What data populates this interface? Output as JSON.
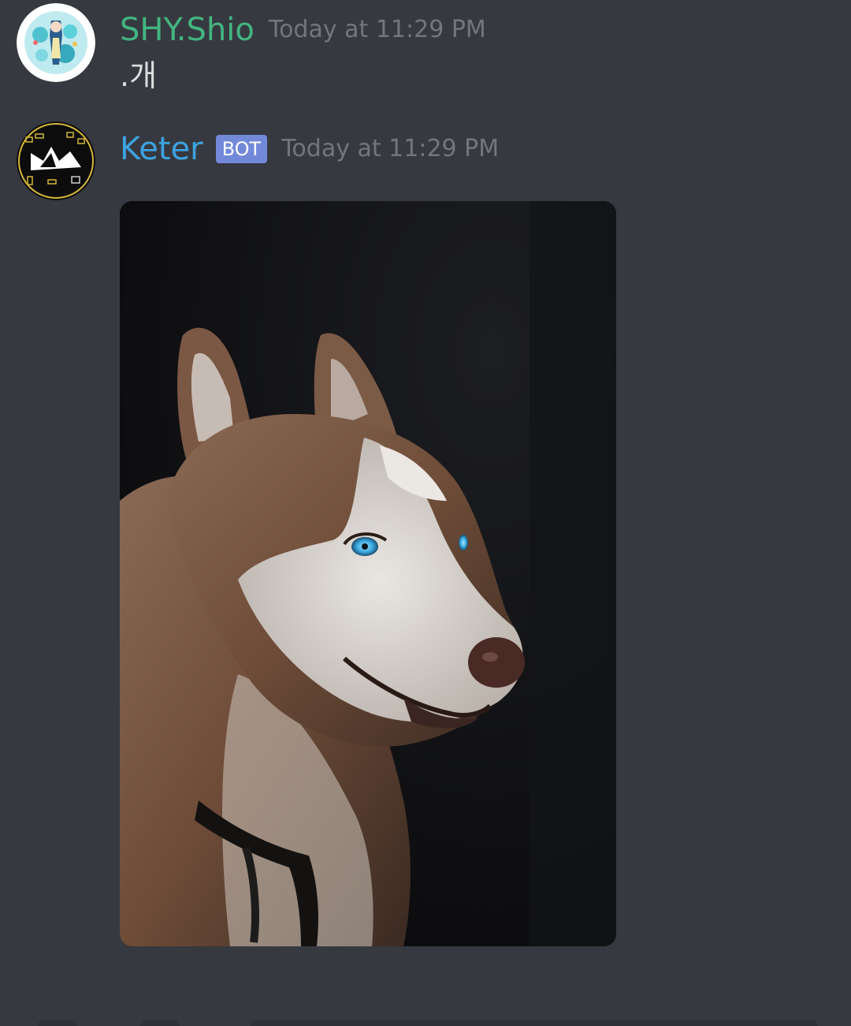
{
  "messages": [
    {
      "author": "SHY.Shio",
      "author_color": "#43b581",
      "timestamp": "Today at 11:29 PM",
      "content": ".개",
      "avatar_icon": "anime-character-avatar"
    },
    {
      "author": "Keter",
      "author_color": "#3ea2e0",
      "bot_tag": "BOT",
      "timestamp": "Today at 11:29 PM",
      "avatar_icon": "keter-bot-logo-avatar",
      "attachment": {
        "type": "image",
        "subject": "husky-dog-photo"
      }
    }
  ],
  "colors": {
    "background": "#36393f",
    "timestamp": "#72767d",
    "bot_tag_bg": "#7289da",
    "message_text": "#dcddde"
  }
}
